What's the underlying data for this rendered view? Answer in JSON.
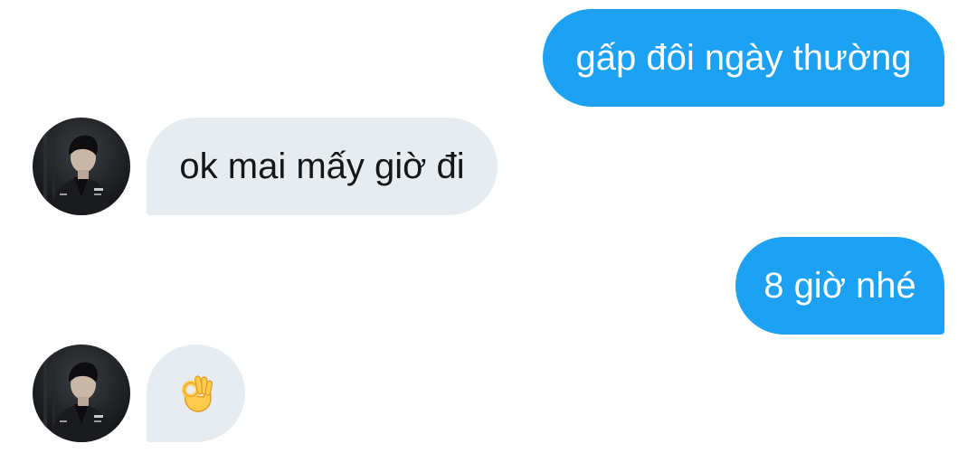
{
  "conversation": {
    "messages": [
      {
        "direction": "sent",
        "text": "gấp đôi ngày thường"
      },
      {
        "direction": "received",
        "text": "ok mai mấy giờ đi"
      },
      {
        "direction": "sent",
        "text": "8 giờ nhé"
      },
      {
        "direction": "received",
        "emoji": "ok-hand-emoji"
      }
    ],
    "colors": {
      "sent_bubble": "#1da1f2",
      "received_bubble": "#e6ecf0",
      "received_text": "#14171a",
      "sent_text": "#ffffff"
    }
  }
}
